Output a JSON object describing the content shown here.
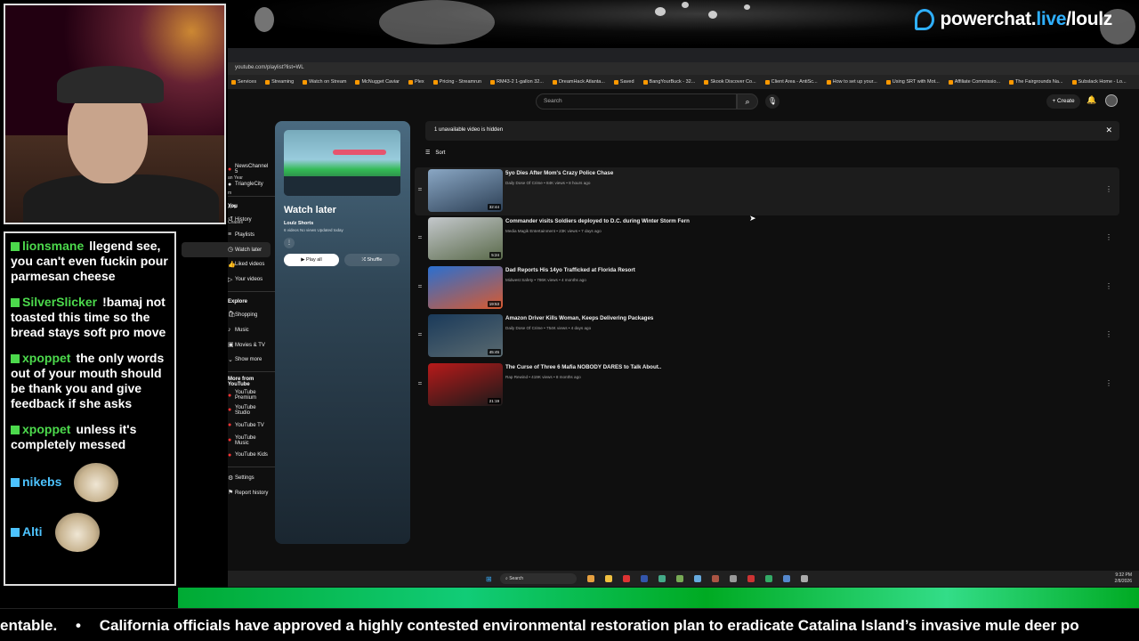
{
  "overlay": {
    "brand_text_a": "powerchat.",
    "brand_text_b": "live",
    "brand_text_c": "/loulz",
    "ticker_left": "entable.",
    "ticker_main": "California officials have approved a highly contested environmental restoration plan to eradicate Catalina Island’s invasive mule deer po"
  },
  "chat": [
    {
      "name": "lionsmane",
      "color": "green",
      "text": "llegend see, you can't even fuckin pour parmesan cheese"
    },
    {
      "name": "SilverSlicker",
      "color": "green",
      "text": "!bamaj not toasted this time so the bread stays soft pro move"
    },
    {
      "name": "xpoppet",
      "color": "green",
      "text": "the only words out of your mouth should be thank you and give feedback if she asks"
    },
    {
      "name": "xpoppet",
      "color": "green",
      "text": "unless it's completely messed"
    },
    {
      "name": "nikebs",
      "color": "blue",
      "text": ""
    },
    {
      "name": "Alti",
      "color": "blue",
      "text": ""
    }
  ],
  "browser": {
    "url": "youtube.com/playlist?list=WL",
    "bookmarks": [
      "Services",
      "Streaming",
      "Watch on Stream",
      "McNugget Caviar",
      "Plex",
      "Pricing - Streamrun",
      "RM43-2 1-gallon 32...",
      "DreamHack Atlanta...",
      "Saved",
      "BangYourBuck - 32...",
      "Skook Discover Co...",
      "Client Area - AntiSc...",
      "How to set up your...",
      "Using SRT with Mot...",
      "Affiliate Commissio...",
      "The Fairgrounds Na...",
      "Subslack Home - Lo..."
    ]
  },
  "youtube": {
    "search_placeholder": "Search",
    "create_label": "Create",
    "clipped_labels": [
      "an Year",
      "m",
      "APE",
      "Chases"
    ],
    "subscriptions": [
      "NewsChannel 5",
      "TriangleCity"
    ],
    "you_label": "You",
    "you_items": [
      "History",
      "Playlists",
      "Watch later",
      "Liked videos",
      "Your videos"
    ],
    "explore_label": "Explore",
    "explore_items": [
      "Shopping",
      "Music",
      "Movies & TV",
      "Show more"
    ],
    "more_label": "More from YouTube",
    "more_items": [
      "YouTube Premium",
      "YouTube Studio",
      "YouTube TV",
      "YouTube Music",
      "YouTube Kids"
    ],
    "settings_label": "Settings",
    "report_label": "Report history",
    "playlist": {
      "title": "Watch later",
      "owner": "Loulz Shorts",
      "meta": "6 videos  No views  Updated today",
      "play_all": "Play all",
      "shuffle": "Shuffle"
    },
    "hidden_notice": "1 unavailable video is hidden",
    "sort_label": "Sort",
    "videos": [
      {
        "title": "5yo Dies After Mom's Crazy Police Chase",
        "meta": "Daily Dose Of Crime • 84K views • 8 hours ago",
        "duration": "32:44",
        "thumb_colors": [
          "#8aa7c4",
          "#2c3f55"
        ]
      },
      {
        "title": "Commander visits Soldiers deployed to D.C. during Winter Storm Fern",
        "meta": "Media Magik Entertainment • 23K views • 7 days ago",
        "duration": "5:24",
        "thumb_colors": [
          "#c4c8cc",
          "#5a6a4a"
        ]
      },
      {
        "title": "Dad Reports His 14yo Trafficked at Florida Resort",
        "meta": "Midwest Safety • 786K views • 4 months ago",
        "duration": "19:53",
        "thumb_colors": [
          "#2a6fd0",
          "#d85a30"
        ]
      },
      {
        "title": "Amazon Driver Kills Woman, Keeps Delivering Packages",
        "meta": "Daily Dose Of Crime • 754K views • 4 days ago",
        "duration": "45:45",
        "thumb_colors": [
          "#1a3a5a",
          "#5a6a70"
        ]
      },
      {
        "title": "The Curse of Three 6 Mafia NOBODY DARES to Talk About..",
        "meta": "Rap Rewind • 419K views • 8 months ago",
        "duration": "21:19",
        "thumb_colors": [
          "#b81a1a",
          "#1a1a1a"
        ]
      }
    ]
  },
  "taskbar": {
    "search_label": "Search",
    "time": "9:32 PM",
    "date": "2/8/2026"
  }
}
